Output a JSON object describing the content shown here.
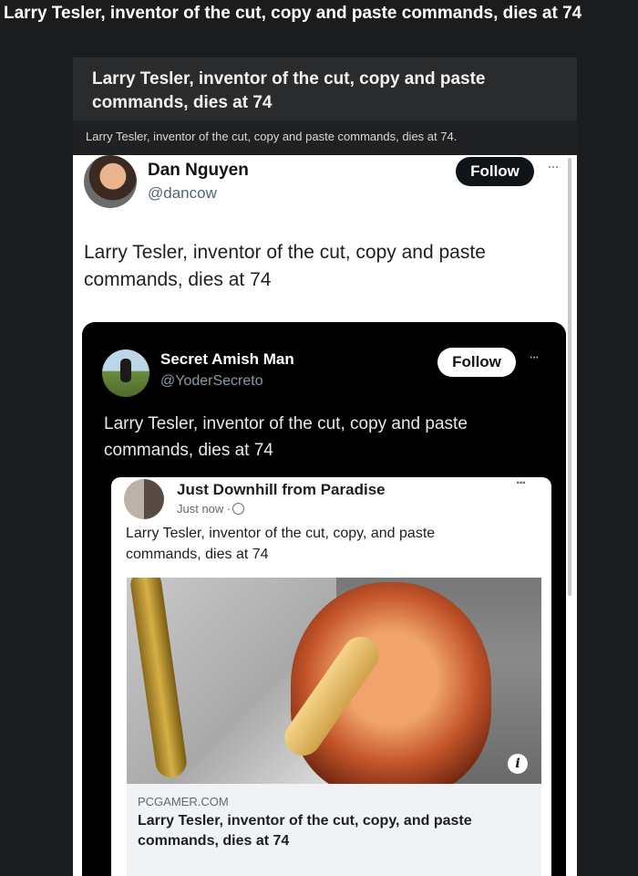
{
  "post_title": "Larry Tesler, inventor of the cut, copy and paste commands, dies at 74",
  "header_card": {
    "title": "Larry Tesler, inventor of the cut, copy and paste commands, dies at 74",
    "subtitle": "Larry Tesler, inventor of the cut, copy and paste commands, dies at 74."
  },
  "tweet_outer": {
    "name": "Dan Nguyen",
    "handle": "@dancow",
    "follow_label": "Follow",
    "more": "···",
    "text": "Larry Tesler, inventor of the cut, copy and paste commands, dies at 74"
  },
  "tweet_inner": {
    "name": "Secret Amish Man",
    "handle": "@YoderSecreto",
    "follow_label": "Follow",
    "more": "···",
    "text": "Larry Tesler, inventor of the cut, copy and paste commands, dies at 74"
  },
  "fb_post": {
    "name": "Just Downhill from Paradise",
    "time": "Just now ·",
    "more": "···",
    "text": "Larry Tesler, inventor of the cut, copy, and paste commands, dies at 74",
    "link_domain": "PCGAMER.COM",
    "link_title": "Larry Tesler, inventor of the cut, copy, and paste commands, dies at 74",
    "info": "i"
  },
  "colors": {
    "background": "#1b1c1e",
    "follow_dark": "#0f1419",
    "inner_tweet_bg": "#000000"
  },
  "icons": [
    "globe-icon",
    "info-icon",
    "more-icon"
  ]
}
